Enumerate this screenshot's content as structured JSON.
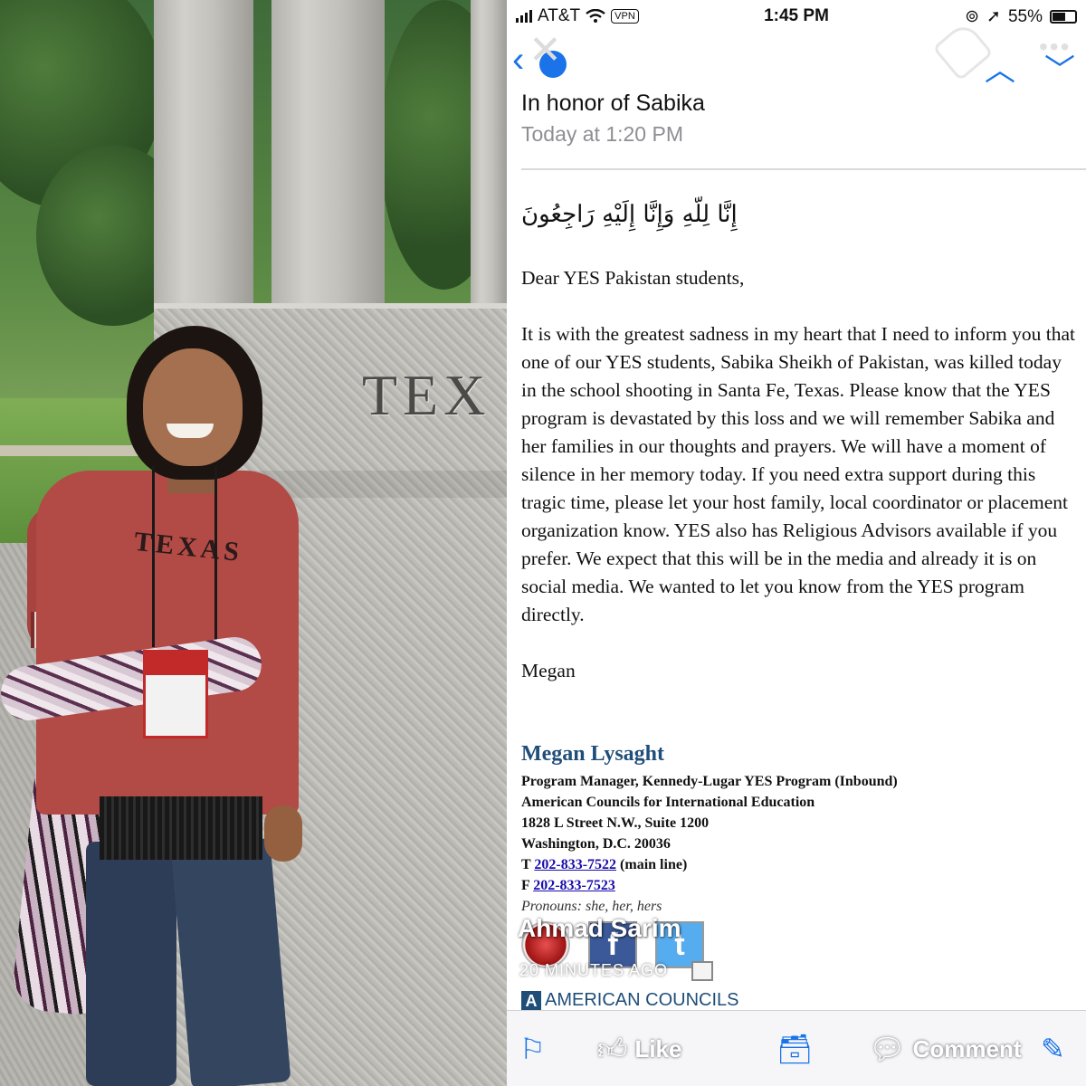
{
  "photo": {
    "carved_text": "TEX",
    "shirt_text": "TEXAS"
  },
  "status_bar": {
    "carrier": "AT&T",
    "vpn": "VPN",
    "time": "1:45 PM",
    "battery": "55%"
  },
  "email": {
    "subject": "In honor of Sabika",
    "date": "Today at 1:20 PM",
    "arabic_line": "إِنَّا لِلّهِ وَإِنَّا إِلَيْهِ رَاجِعُونَ",
    "greeting": "Dear YES Pakistan students,",
    "body": "It is with the greatest sadness in my heart that I need to inform you that one of our YES students, Sabika Sheikh of Pakistan, was killed today in the school shooting in Santa Fe, Texas. Please know that the YES program is devastated by this loss and we will remember Sabika and her families in our thoughts and prayers. We will have a moment of silence in her memory today. If you need extra support during this tragic time, please let your host family, local coordinator or placement organization know. YES also has Religious Advisors available if you prefer. We expect that this will be in the media and already it is on social media. We wanted to let you know from the YES program directly.",
    "closing": "Megan"
  },
  "signature": {
    "name": "Megan Lysaght",
    "title": "Program Manager, Kennedy-Lugar YES Program (Inbound)",
    "org": "American Councils for International Education",
    "street": "1828 L Street N.W., Suite 1200",
    "city": "Washington, D.C. 20036",
    "phone_prefix": "T ",
    "phone": "202-833-7522",
    "phone_suffix": " (main line)",
    "fax_prefix": "F ",
    "fax": "202-833-7523",
    "pronouns": "Pronouns: she, her, hers",
    "logo_text": "AMERICAN COUNCILS"
  },
  "overlay": {
    "author": "Ahmad Sarim",
    "time_ago": "20 MINUTES AGO"
  },
  "toolbar": {
    "like": "Like",
    "comment": "Comment"
  },
  "colors": {
    "accent": "#1a73e8",
    "signature_name": "#1f4e79",
    "link": "#1a0dab"
  }
}
